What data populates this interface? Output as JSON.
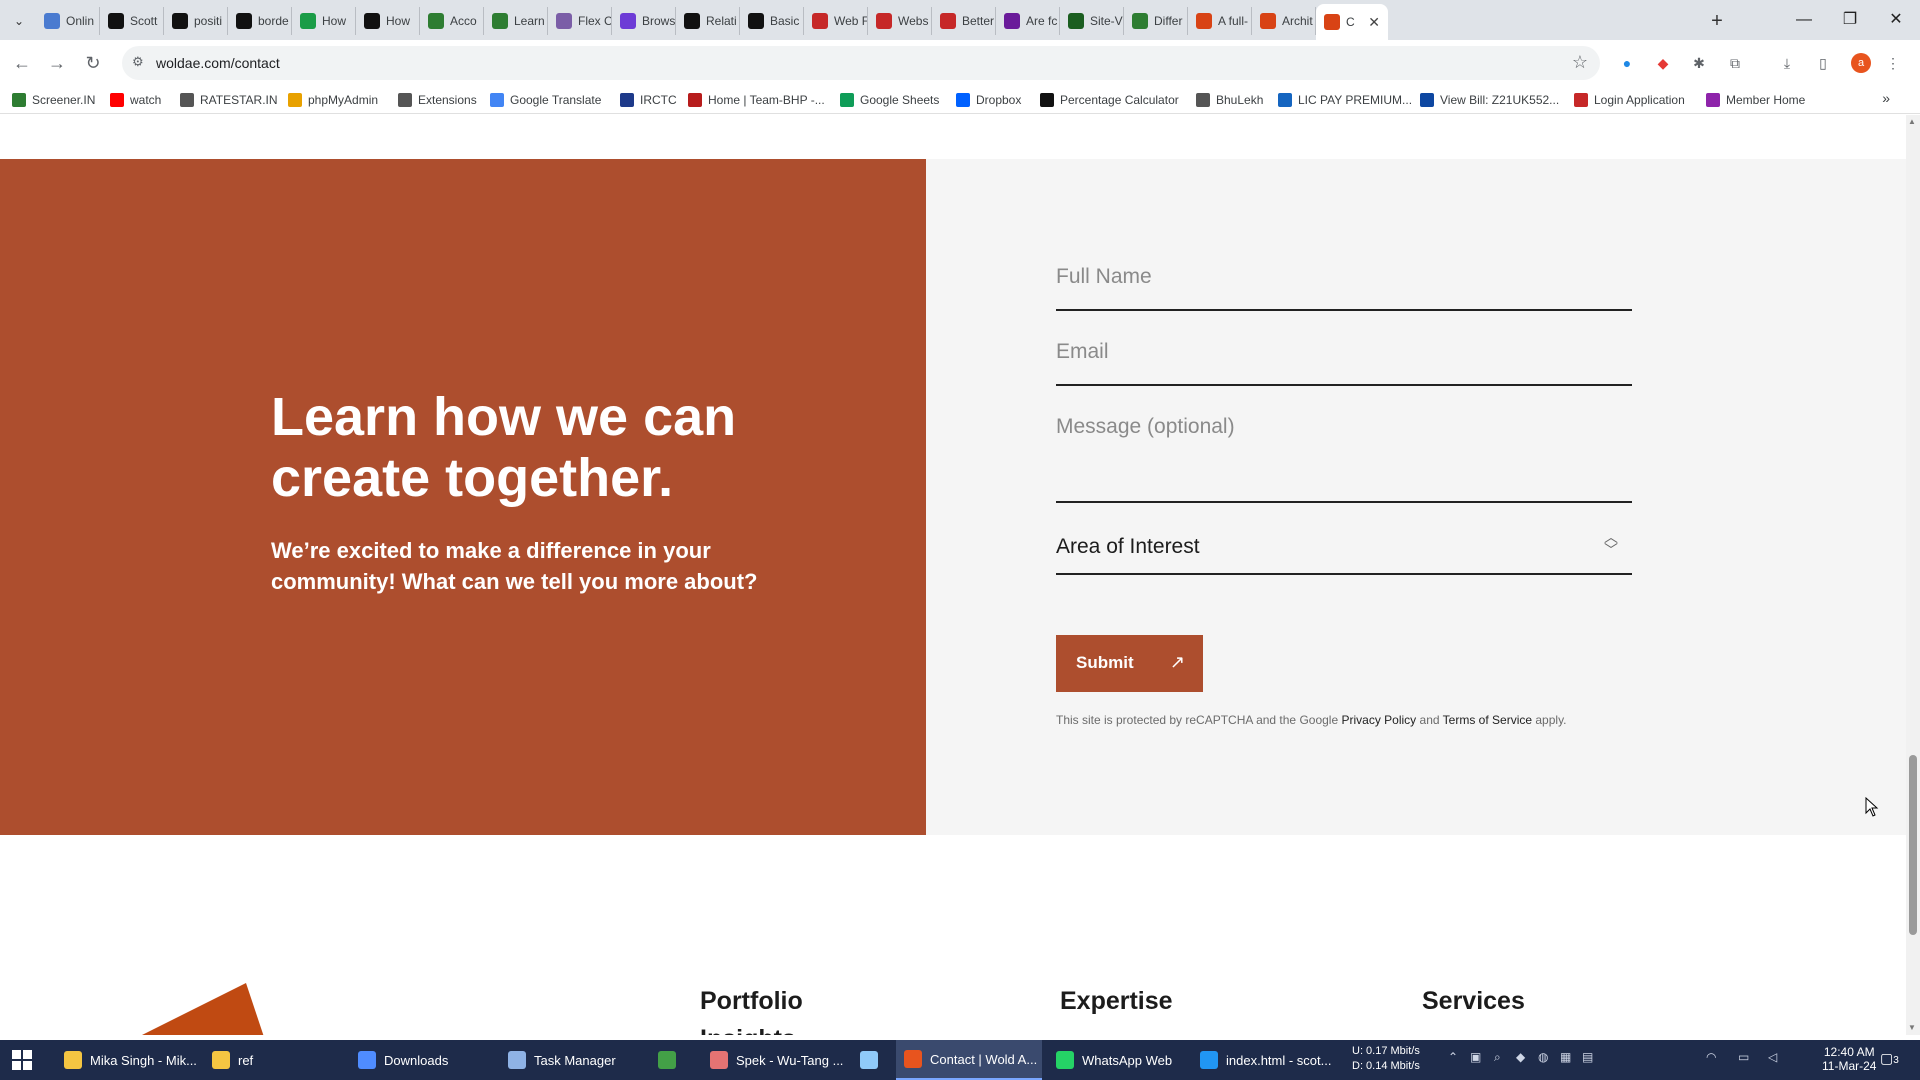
{
  "browser": {
    "tabs": [
      {
        "label": "Onlin",
        "icon": "globe-icon",
        "color": "#4a7bd0"
      },
      {
        "label": "Scott",
        "icon": "s-icon",
        "color": "#111111"
      },
      {
        "label": "positi",
        "icon": "m-icon",
        "color": "#111111"
      },
      {
        "label": "borde",
        "icon": "m-icon",
        "color": "#111111"
      },
      {
        "label": "How",
        "icon": "w-icon",
        "color": "#1a9c47"
      },
      {
        "label": "How",
        "icon": "a-icon",
        "color": "#111111"
      },
      {
        "label": "Acco",
        "icon": "link-icon",
        "color": "#2e7d32"
      },
      {
        "label": "Learn",
        "icon": "leaf-icon",
        "color": "#2e7d32"
      },
      {
        "label": "Flex C",
        "icon": "ring-icon",
        "color": "#7b5ea7"
      },
      {
        "label": "Brows",
        "icon": "b-icon",
        "color": "#6d3bd6"
      },
      {
        "label": "Relati",
        "icon": "m-icon",
        "color": "#111111"
      },
      {
        "label": "Basic",
        "icon": "m-icon",
        "color": "#111111"
      },
      {
        "label": "Web F",
        "icon": "nn-icon",
        "color": "#c62828"
      },
      {
        "label": "Webs",
        "icon": "target-icon",
        "color": "#c62828"
      },
      {
        "label": "Better",
        "icon": "nn-icon",
        "color": "#c62828"
      },
      {
        "label": "Are fc",
        "icon": "butterfly-icon",
        "color": "#6a1b9a"
      },
      {
        "label": "Site-V",
        "icon": "n-icon",
        "color": "#1b5e20"
      },
      {
        "label": "Differ",
        "icon": "link-icon",
        "color": "#2e7d32"
      },
      {
        "label": "A full-",
        "icon": "w-icon",
        "color": "#d84315"
      },
      {
        "label": "Archit",
        "icon": "w-icon",
        "color": "#d84315"
      },
      {
        "label": "C",
        "icon": "w-icon",
        "color": "#d84315"
      }
    ],
    "url": "woldae.com/contact",
    "bookmarks": [
      {
        "label": "Screener.IN",
        "color": "#2e7d32"
      },
      {
        "label": "watch",
        "color": "#ff0000"
      },
      {
        "label": "RATESTAR.IN",
        "color": "#555555"
      },
      {
        "label": "phpMyAdmin",
        "color": "#e8a100"
      },
      {
        "label": "Extensions",
        "color": "#555555"
      },
      {
        "label": "Google Translate",
        "color": "#4285f4"
      },
      {
        "label": "IRCTC",
        "color": "#1e3a8a"
      },
      {
        "label": "Home | Team-BHP -...",
        "color": "#b71c1c"
      },
      {
        "label": "Google Sheets",
        "color": "#0f9d58"
      },
      {
        "label": "Dropbox",
        "color": "#0061ff"
      },
      {
        "label": "Percentage Calculator",
        "color": "#111111"
      },
      {
        "label": "BhuLekh",
        "color": "#555555"
      },
      {
        "label": "LIC PAY PREMIUM...",
        "color": "#1565c0"
      },
      {
        "label": "View Bill: Z21UK552...",
        "color": "#0d47a1"
      },
      {
        "label": "Login Application",
        "color": "#c62828"
      },
      {
        "label": "Member Home",
        "color": "#8e24aa"
      }
    ]
  },
  "page": {
    "hero_title": "Learn how we can create together.",
    "hero_subtitle": "We’re excited to make a difference in your community! What can we tell you more about?",
    "form": {
      "full_name_placeholder": "Full Name",
      "email_placeholder": "Email",
      "message_placeholder": "Message (optional)",
      "area_of_interest": "Area of Interest",
      "submit_label": "Submit"
    },
    "recaptcha": {
      "prefix": "This site is protected by reCAPTCHA and the Google",
      "privacy": "Privacy Policy",
      "and": "and",
      "terms": "Terms of Service",
      "suffix": "apply."
    },
    "footer": {
      "col1": "Portfolio",
      "col1_sub": "Insights",
      "col2": "Expertise",
      "col3": "Services"
    },
    "colors": {
      "brand": "#ad4e2e",
      "form_bg": "#f5f5f5"
    }
  },
  "taskbar": {
    "items": [
      {
        "label": "Mika Singh - Mik...",
        "color": "#f4c542"
      },
      {
        "label": "ref",
        "color": "#f4c542"
      },
      {
        "label": "Downloads",
        "color": "#4f8cff"
      },
      {
        "label": "Task Manager",
        "color": "#8fb3e6"
      },
      {
        "label": "",
        "color": "#43a047"
      },
      {
        "label": "Spek - Wu-Tang ...",
        "color": "#e57373"
      },
      {
        "label": "",
        "color": "#90caf9"
      },
      {
        "label": "Contact | Wold A...",
        "color": "#e8541e"
      },
      {
        "label": "WhatsApp Web",
        "color": "#25d366"
      },
      {
        "label": "index.html - scot...",
        "color": "#2196f3"
      }
    ],
    "net_up": "U:    0.17 Mbit/s",
    "net_down": "D:    0.14 Mbit/s",
    "time": "12:40 AM",
    "date": "11-Mar-24",
    "notifications": "3"
  }
}
